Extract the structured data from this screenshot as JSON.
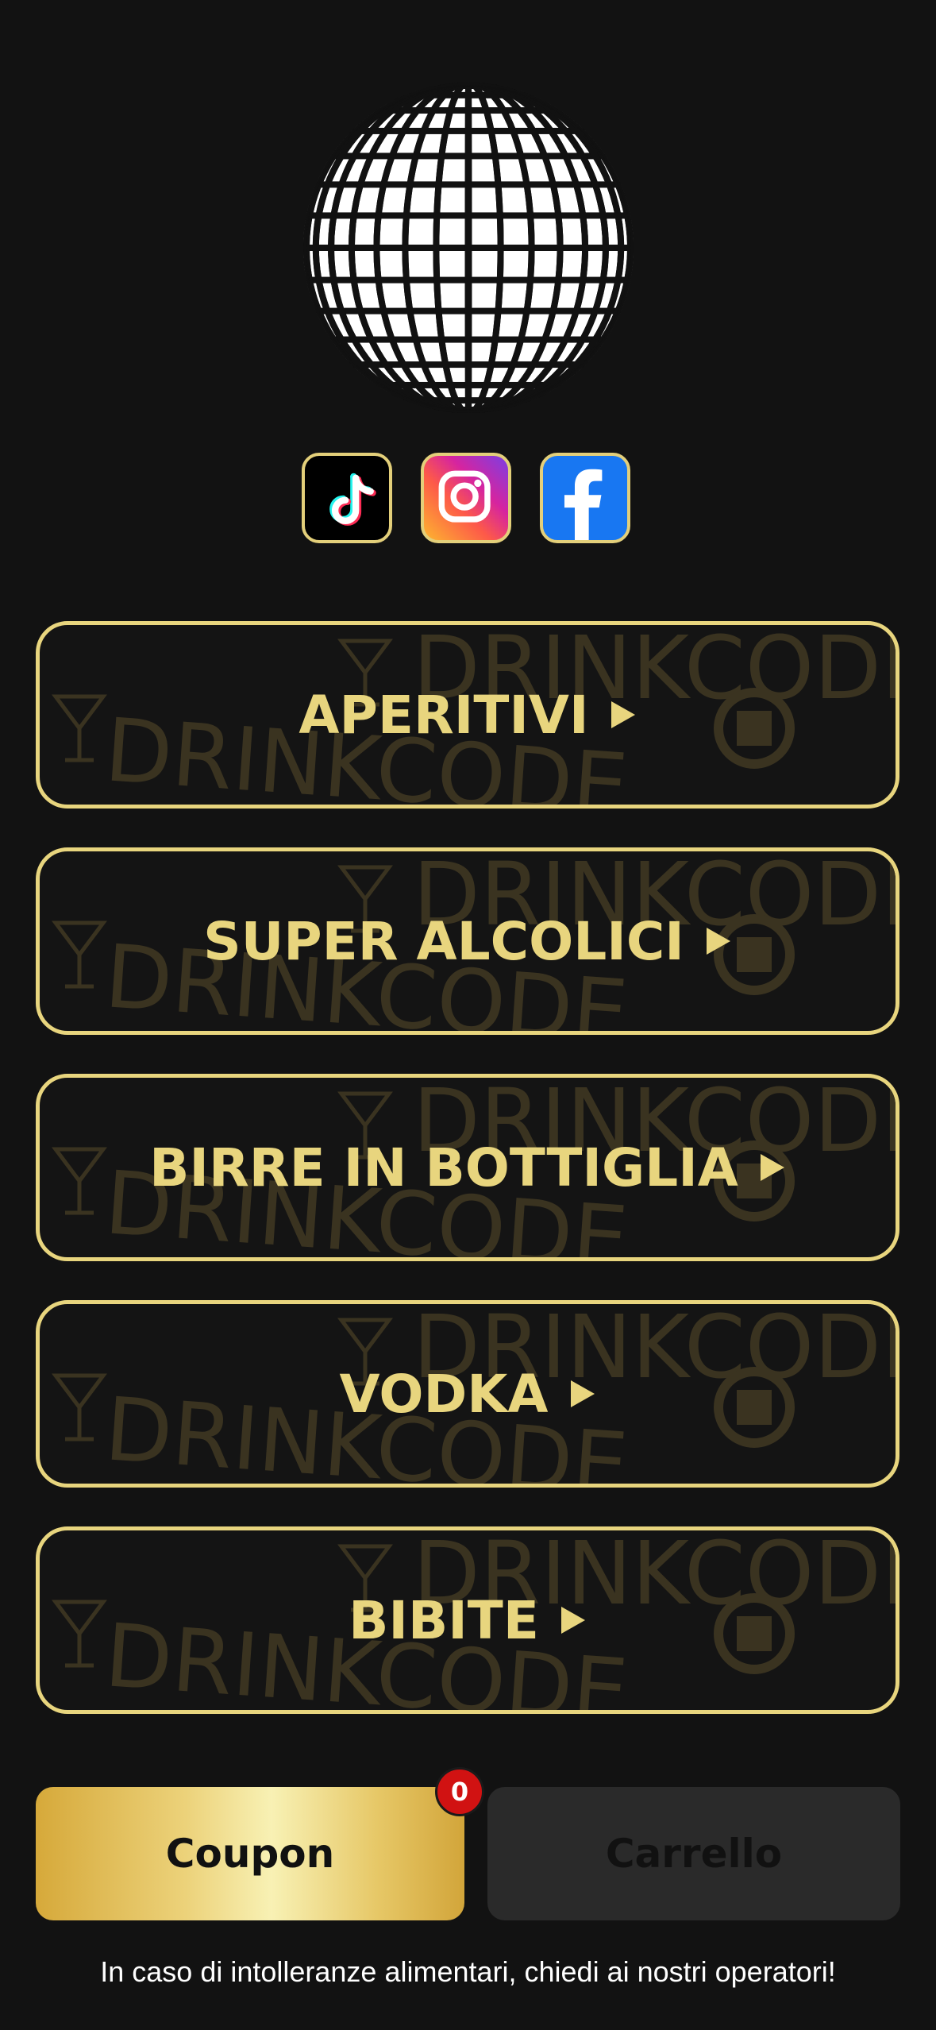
{
  "logo": {
    "icon": "disco-ball-icon"
  },
  "social": [
    {
      "name": "tiktok",
      "icon": "tiktok-icon"
    },
    {
      "name": "instagram",
      "icon": "instagram-icon"
    },
    {
      "name": "facebook",
      "icon": "facebook-icon"
    }
  ],
  "categories": [
    {
      "label": "APERITIVI"
    },
    {
      "label": "SUPER ALCOLICI"
    },
    {
      "label": "BIRRE IN BOTTIGLIA"
    },
    {
      "label": "VODKA"
    },
    {
      "label": "BIBITE"
    }
  ],
  "watermark": {
    "text": "DRINKCODE"
  },
  "actions": {
    "coupon_label": "Coupon",
    "coupon_count": "0",
    "cart_label": "Carrello"
  },
  "footer": {
    "note": "In caso di intolleranze alimentari, chiedi ai nostri operatori!"
  },
  "colors": {
    "background": "#121212",
    "accent": "#e8d57e",
    "badge": "#d11212",
    "cart_bg": "#2a2a2a"
  }
}
